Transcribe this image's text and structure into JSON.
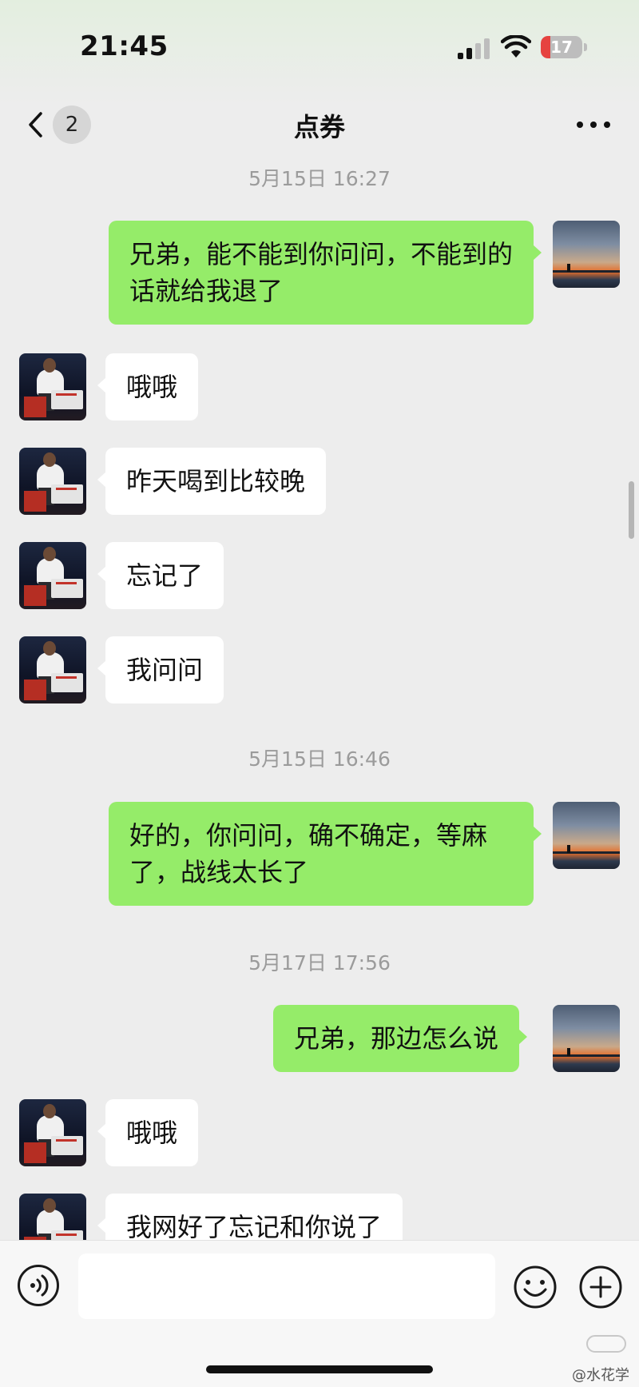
{
  "status_bar": {
    "time": "21:45",
    "battery_level": "17"
  },
  "nav": {
    "unread_count": "2",
    "title": "点券"
  },
  "messages": {
    "ts1": "5月15日 16:27",
    "m1": "兄弟，能不能到你问问，不能到的话就给我退了",
    "m2": "哦哦",
    "m3": "昨天喝到比较晚",
    "m4": "忘记了",
    "m5": "我问问",
    "ts2": "5月15日 16:46",
    "m6": "好的，你问问，确不确定，等麻了，战线太长了",
    "ts3": "5月17日 17:56",
    "m7": "兄弟，那边怎么说",
    "m8": "哦哦",
    "m9": "我网好了忘记和你说了"
  },
  "input": {
    "placeholder": ""
  },
  "watermark": "@水花学",
  "colors": {
    "outgoing_bubble": "#95EC69",
    "incoming_bubble": "#FFFFFF",
    "background": "#EDEDED",
    "battery_low": "#E64340"
  },
  "icons": {
    "back": "chevron-left-icon",
    "more": "more-dots-icon",
    "voice": "voice-icon",
    "emoji": "emoji-icon",
    "plus": "plus-icon"
  }
}
